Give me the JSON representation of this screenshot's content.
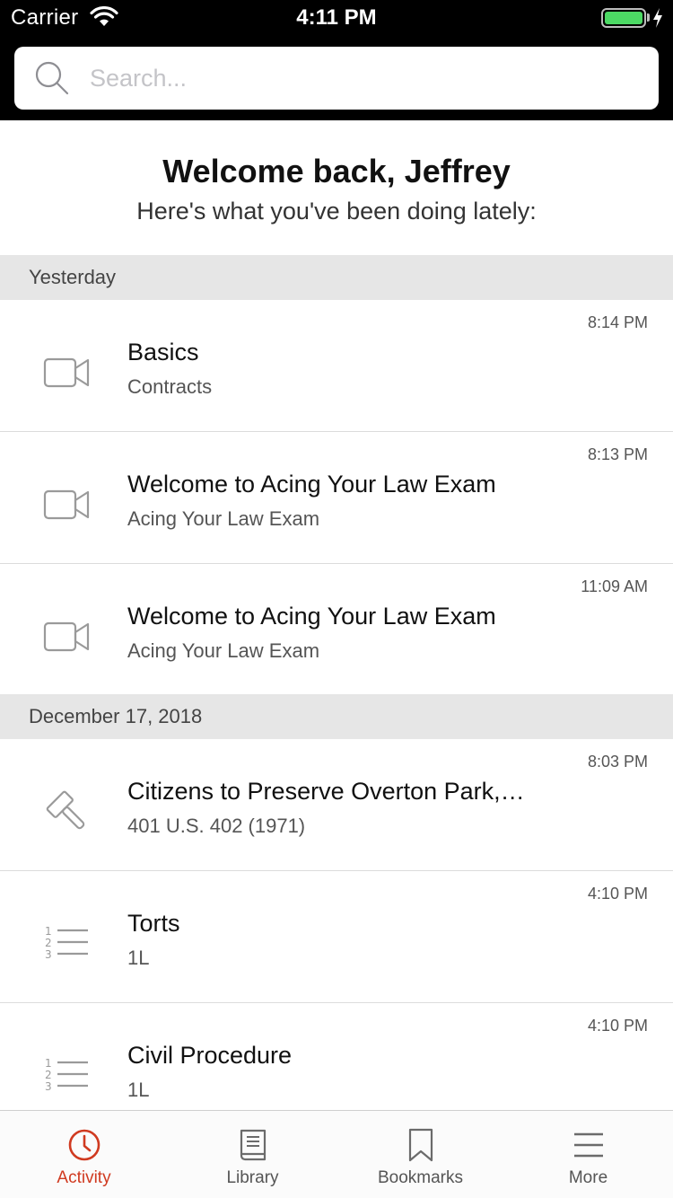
{
  "status_bar": {
    "carrier": "Carrier",
    "time": "4:11 PM",
    "wifi_icon": "wifi-icon",
    "battery_icon": "battery-icon",
    "battery_color": "#4cd964",
    "charging_icon": "bolt-icon"
  },
  "search": {
    "placeholder": "Search...",
    "value": "",
    "icon": "search-icon"
  },
  "welcome": {
    "title": "Welcome back, Jeffrey",
    "subtitle": "Here's what you've been doing lately:"
  },
  "sections": [
    {
      "label": "Yesterday",
      "items": [
        {
          "icon": "video-icon",
          "title": "Basics",
          "subtitle": "Contracts",
          "time": "8:14 PM"
        },
        {
          "icon": "video-icon",
          "title": "Welcome to Acing Your Law Exam",
          "subtitle": "Acing Your Law Exam",
          "time": "8:13 PM"
        },
        {
          "icon": "video-icon",
          "title": "Welcome to Acing Your Law Exam",
          "subtitle": "Acing Your Law Exam",
          "time": "11:09 AM"
        }
      ]
    },
    {
      "label": "December 17, 2018",
      "items": [
        {
          "icon": "gavel-icon",
          "title": "Citizens to Preserve Overton Park,…",
          "subtitle": "401 U.S. 402 (1971)",
          "time": "8:03 PM"
        },
        {
          "icon": "numbered-list-icon",
          "title": "Torts",
          "subtitle": "1L",
          "time": "4:10 PM"
        },
        {
          "icon": "numbered-list-icon",
          "title": "Civil Procedure",
          "subtitle": "1L",
          "time": "4:10 PM"
        }
      ]
    }
  ],
  "tabbar": {
    "active_color": "#d03a20",
    "tabs": [
      {
        "label": "Activity",
        "icon": "clock-icon",
        "active": true
      },
      {
        "label": "Library",
        "icon": "book-icon",
        "active": false
      },
      {
        "label": "Bookmarks",
        "icon": "bookmark-icon",
        "active": false
      },
      {
        "label": "More",
        "icon": "menu-icon",
        "active": false
      }
    ]
  }
}
